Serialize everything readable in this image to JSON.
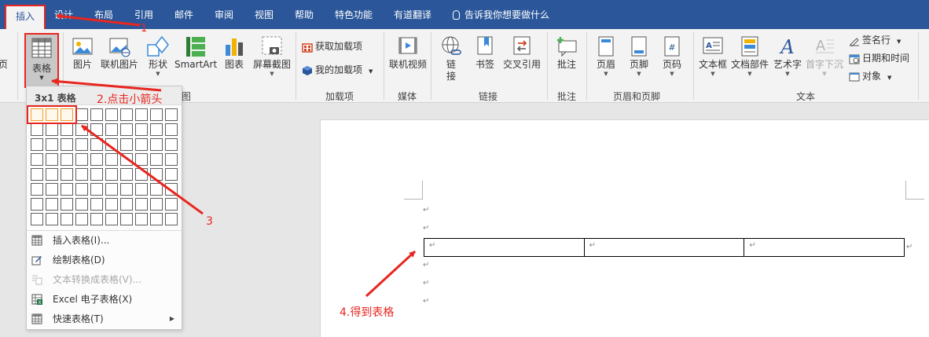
{
  "tabs": [
    {
      "label": "插入",
      "active": true
    },
    {
      "label": "设计"
    },
    {
      "label": "布局"
    },
    {
      "label": "引用"
    },
    {
      "label": "邮件"
    },
    {
      "label": "审阅"
    },
    {
      "label": "视图"
    },
    {
      "label": "帮助"
    },
    {
      "label": "特色功能"
    },
    {
      "label": "有道翻译"
    }
  ],
  "tell_me": "告诉我你想要做什么",
  "ribbon": {
    "partial_left": "页",
    "tables": {
      "table_label": "表格"
    },
    "illustrations": {
      "picture": "图片",
      "online_picture": "联机图片",
      "shapes": "形状",
      "smartart": "SmartArt",
      "chart": "图表",
      "screenshot": "屏幕截图",
      "group_label_tail": "图"
    },
    "addins": {
      "get": "获取加载项",
      "mine": "我的加载项",
      "group_label": "加载项"
    },
    "media": {
      "online_video": "联机视频",
      "group_label": "媒体"
    },
    "links": {
      "link": "链\n接",
      "bookmark": "书签",
      "cross_ref": "交叉引用",
      "group_label": "链接"
    },
    "comments": {
      "comment": "批注",
      "group_label": "批注"
    },
    "header_footer": {
      "header": "页眉",
      "footer": "页脚",
      "page_number": "页码",
      "group_label": "页眉和页脚"
    },
    "text": {
      "textbox": "文本框",
      "quickparts": "文档部件",
      "wordart": "艺术字",
      "dropcap": "首字下沉",
      "signature": "签名行",
      "datetime": "日期和时间",
      "object": "对象",
      "group_label": "文本"
    }
  },
  "dropdown": {
    "title": "3x1 表格",
    "grid": {
      "cols": 10,
      "rows": 8,
      "selected_cols": 3,
      "selected_rows": 1
    },
    "items": [
      {
        "label": "插入表格(I)...",
        "enabled": true
      },
      {
        "label": "绘制表格(D)",
        "enabled": true
      },
      {
        "label": "文本转换成表格(V)...",
        "enabled": false
      },
      {
        "label": "Excel 电子表格(X)",
        "enabled": true
      },
      {
        "label": "快速表格(T)",
        "enabled": true,
        "submenu": true
      }
    ]
  },
  "document": {
    "paragraph_mark": "↵",
    "table": {
      "cols": 3,
      "cells": [
        "↵",
        "↵",
        "↵"
      ],
      "row_end": "↵"
    }
  },
  "annotations": {
    "step1": "1",
    "step2": "2.点击小箭头",
    "step3": "3",
    "step4": "4.得到表格"
  },
  "colors": {
    "accent": "#2b579a",
    "annotation": "#e8261f",
    "highlight": "#f39c26"
  }
}
